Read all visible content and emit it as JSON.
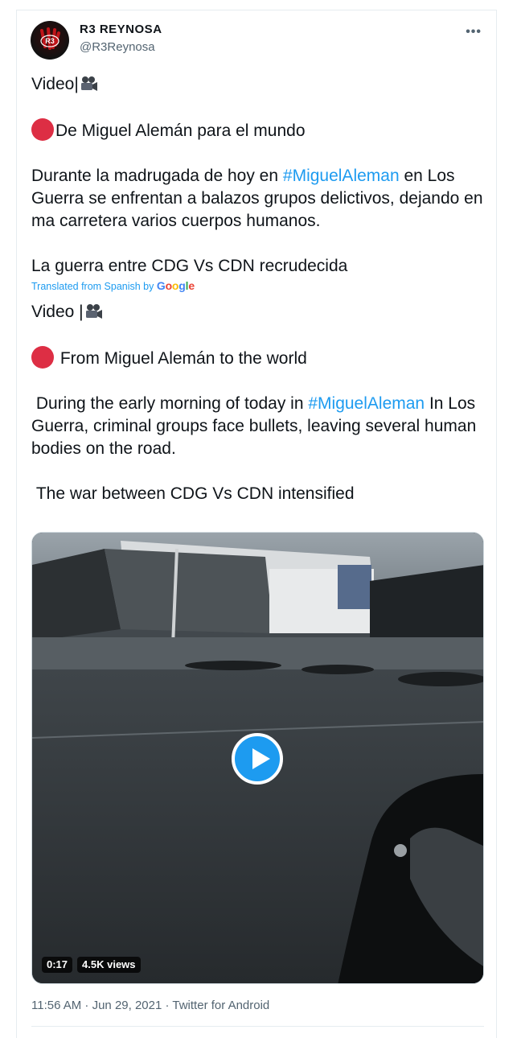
{
  "tweet": {
    "author_name": "R3 REYNOSA",
    "author_handle": "@R3Reynosa",
    "more_label": "•••",
    "original": {
      "line1": "Video|",
      "line2": "De Miguel Alemán para el mundo",
      "para_start": "Durante la madrugada de hoy en ",
      "hashtag": "#MiguelAleman",
      "para_end": " en Los Guerra se enfrentan a balazos grupos delictivos, dejando en ma carretera varios cuerpos humanos.",
      "closing": "La guerra entre CDG Vs CDN recrudecida"
    },
    "translation_note": "Translated from Spanish by ",
    "google": [
      "G",
      "o",
      "o",
      "g",
      "l",
      "e"
    ],
    "translated": {
      "line1": "Video |",
      "line2": " From Miguel Alemán to the world",
      "para_start": " During the early morning of today in ",
      "hashtag": "#MiguelAleman",
      "para_end": " In Los Guerra, criminal groups face bullets, leaving several human bodies on the road.",
      "closing": " The war between CDG Vs CDN intensified"
    },
    "video": {
      "duration": "0:17",
      "views": "4.5K views"
    },
    "meta": "11:56 AM · Jun 29, 2021 · Twitter for Android"
  },
  "colors": {
    "link": "#1d9bf0",
    "secondary": "#536471",
    "red_circle": "#dd2e44"
  }
}
